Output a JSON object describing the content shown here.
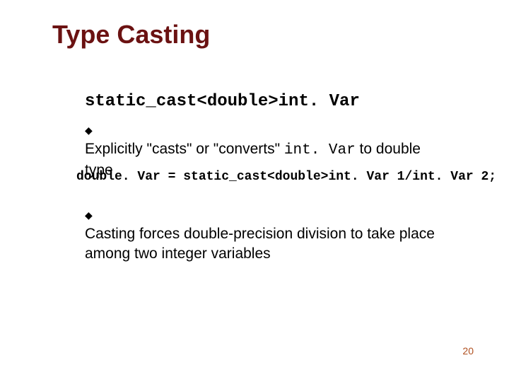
{
  "title": "Type Casting",
  "headline": "static_cast<double>int. Var",
  "bullets": [
    {
      "pre": "Explicitly \"casts\" or \"converts\" ",
      "mono": "int. Var",
      "post": " to double type"
    },
    {
      "pre": "Casting forces double-precision division to take place among two integer variables",
      "mono": "",
      "post": ""
    }
  ],
  "code_line": "double. Var = static_cast<double>int. Var 1/int. Var 2;",
  "page_number": "20",
  "chart_data": null
}
